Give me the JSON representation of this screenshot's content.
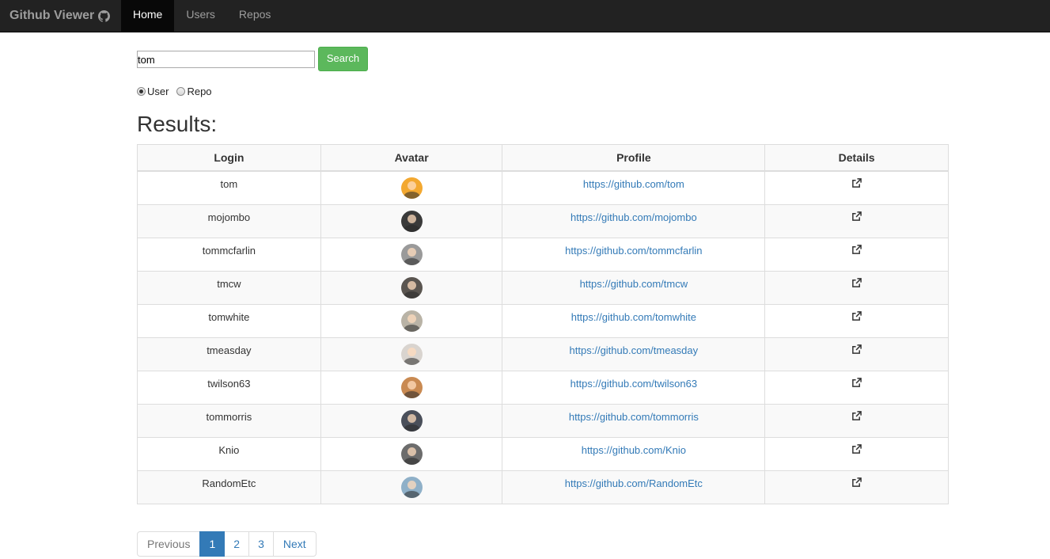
{
  "navbar": {
    "brand": "Github Viewer",
    "brand_icon": "github-octocat-icon",
    "items": [
      {
        "label": "Home",
        "active": true
      },
      {
        "label": "Users",
        "active": false
      },
      {
        "label": "Repos",
        "active": false
      }
    ]
  },
  "search": {
    "value": "tom",
    "button_label": "Search"
  },
  "search_type": {
    "options": [
      {
        "label": "User",
        "checked": true
      },
      {
        "label": "Repo",
        "checked": false
      }
    ]
  },
  "results": {
    "title": "Results:",
    "columns": [
      "Login",
      "Avatar",
      "Profile",
      "Details"
    ],
    "rows": [
      {
        "login": "tom",
        "profile": "https://github.com/tom",
        "avatar_color": "#f3a830"
      },
      {
        "login": "mojombo",
        "profile": "https://github.com/mojombo",
        "avatar_color": "#3a3a3a"
      },
      {
        "login": "tommcfarlin",
        "profile": "https://github.com/tommcfarlin",
        "avatar_color": "#9a9a9a"
      },
      {
        "login": "tmcw",
        "profile": "https://github.com/tmcw",
        "avatar_color": "#5a5550"
      },
      {
        "login": "tomwhite",
        "profile": "https://github.com/tomwhite",
        "avatar_color": "#b9b3a6"
      },
      {
        "login": "tmeasday",
        "profile": "https://github.com/tmeasday",
        "avatar_color": "#d9d4cf"
      },
      {
        "login": "twilson63",
        "profile": "https://github.com/twilson63",
        "avatar_color": "#c98a52"
      },
      {
        "login": "tommorris",
        "profile": "https://github.com/tommorris",
        "avatar_color": "#4a4f5a"
      },
      {
        "login": "Knio",
        "profile": "https://github.com/Knio",
        "avatar_color": "#6c6c6c"
      },
      {
        "login": "RandomEtc",
        "profile": "https://github.com/RandomEtc",
        "avatar_color": "#8fb0c8"
      }
    ]
  },
  "pagination": {
    "previous": "Previous",
    "pages": [
      "1",
      "2",
      "3"
    ],
    "active_page": "1",
    "next": "Next"
  },
  "colors": {
    "navbar_bg": "#222222",
    "search_button": "#5cb85c",
    "link": "#337ab7"
  }
}
